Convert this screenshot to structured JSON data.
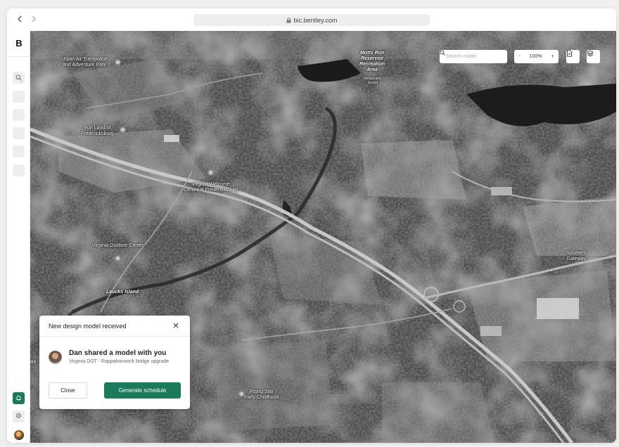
{
  "browser": {
    "url": "bic.bentley.com",
    "back_icon": "chevron-left-icon",
    "forward_icon": "chevron-right-icon"
  },
  "sidebar": {
    "logo": "B",
    "icons": [
      "search-icon",
      "bell-icon",
      "gear-icon"
    ],
    "accent_color": "#1b7a5c"
  },
  "map": {
    "search_placeholder": "Search model",
    "zoom_minus": "-",
    "zoom_level": "100%",
    "zoom_plus": "+",
    "labels": {
      "trampoline": "Urban Air Trampoline\nand Adventure Park",
      "motts": "Motts Run\nReservoir\nRecreation\nArea",
      "motts_note": "Temporarily\nclosed",
      "funland": "Fun Land of\nFredericksburg",
      "welcome": "Virginia Welcome\nCenter at Fredericksburg",
      "outdoor": "Virginia Outdoor Center",
      "laucks": "Laucks Island",
      "gateway": "Southern\nGateway",
      "rising": "Rising Star\nEarly Childhood",
      "partial": "Be"
    }
  },
  "notification": {
    "title": "New design model received",
    "message": "Dan shared a model with you",
    "detail": "Virginia DOT - Rappahannock bridge upgrade",
    "close_label": "Close",
    "action_label": "Generate schedule"
  }
}
